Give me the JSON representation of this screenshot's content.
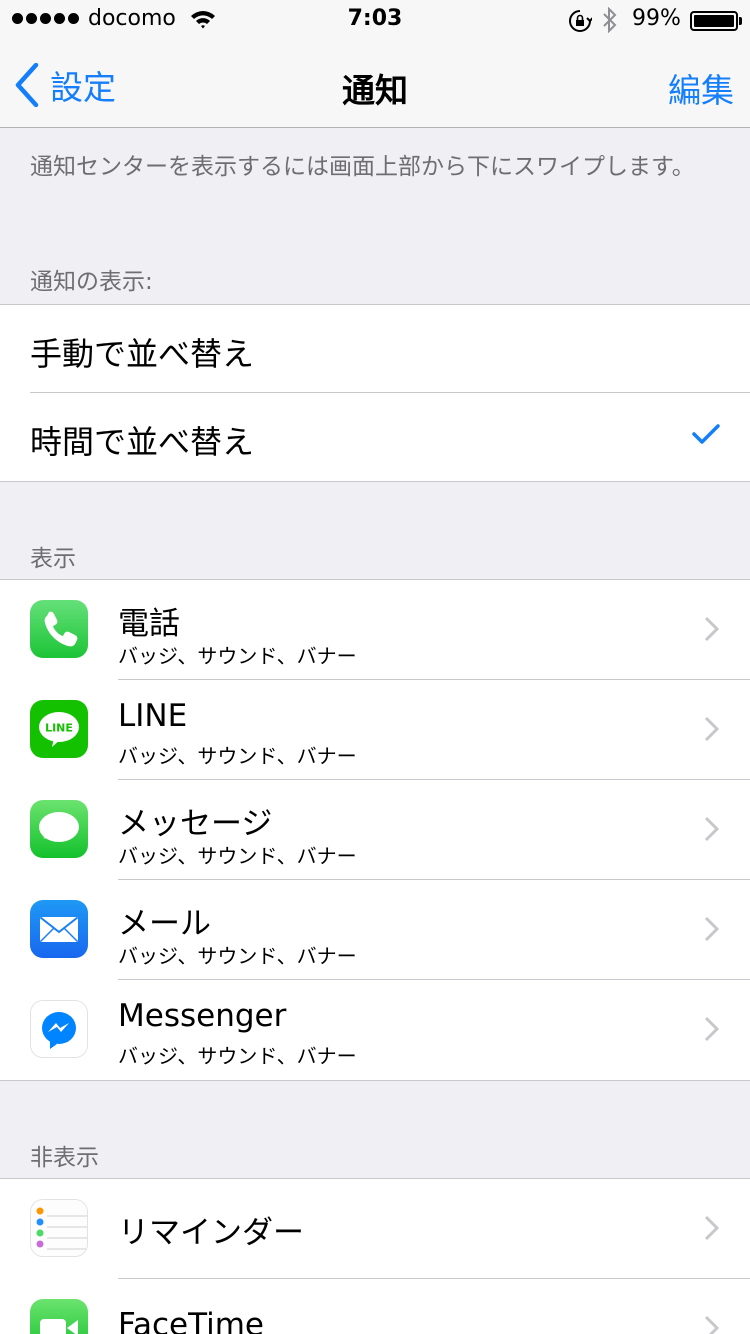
{
  "status_bar": {
    "carrier": "docomo",
    "time": "7:03",
    "battery_text": "99%",
    "battery_level": 0.99
  },
  "nav": {
    "back_label": "設定",
    "title": "通知",
    "edit_label": "編集"
  },
  "note": "通知センターを表示するには画面上部から下にスワイプします。",
  "sort": {
    "header": "通知の表示:",
    "options": [
      {
        "label": "手動で並べ替え",
        "selected": false
      },
      {
        "label": "時間で並べ替え",
        "selected": true
      }
    ]
  },
  "shown": {
    "header": "表示",
    "apps": [
      {
        "name": "電話",
        "detail": "バッジ、サウンド、バナー",
        "icon": "phone-icon"
      },
      {
        "name": "LINE",
        "detail": "バッジ、サウンド、バナー",
        "icon": "line-icon",
        "icon_text": "LINE"
      },
      {
        "name": "メッセージ",
        "detail": "バッジ、サウンド、バナー",
        "icon": "messages-icon"
      },
      {
        "name": "メール",
        "detail": "バッジ、サウンド、バナー",
        "icon": "mail-icon"
      },
      {
        "name": "Messenger",
        "detail": "バッジ、サウンド、バナー",
        "icon": "messenger-icon"
      }
    ]
  },
  "hidden": {
    "header": "非表示",
    "apps": [
      {
        "name": "リマインダー",
        "icon": "reminders-icon"
      },
      {
        "name": "FaceTime",
        "icon": "facetime-icon"
      }
    ]
  },
  "colors": {
    "accent": "#157efb",
    "background": "#efeff4",
    "secondary_text": "#6d6d72",
    "separator": "#c8c7cc"
  }
}
